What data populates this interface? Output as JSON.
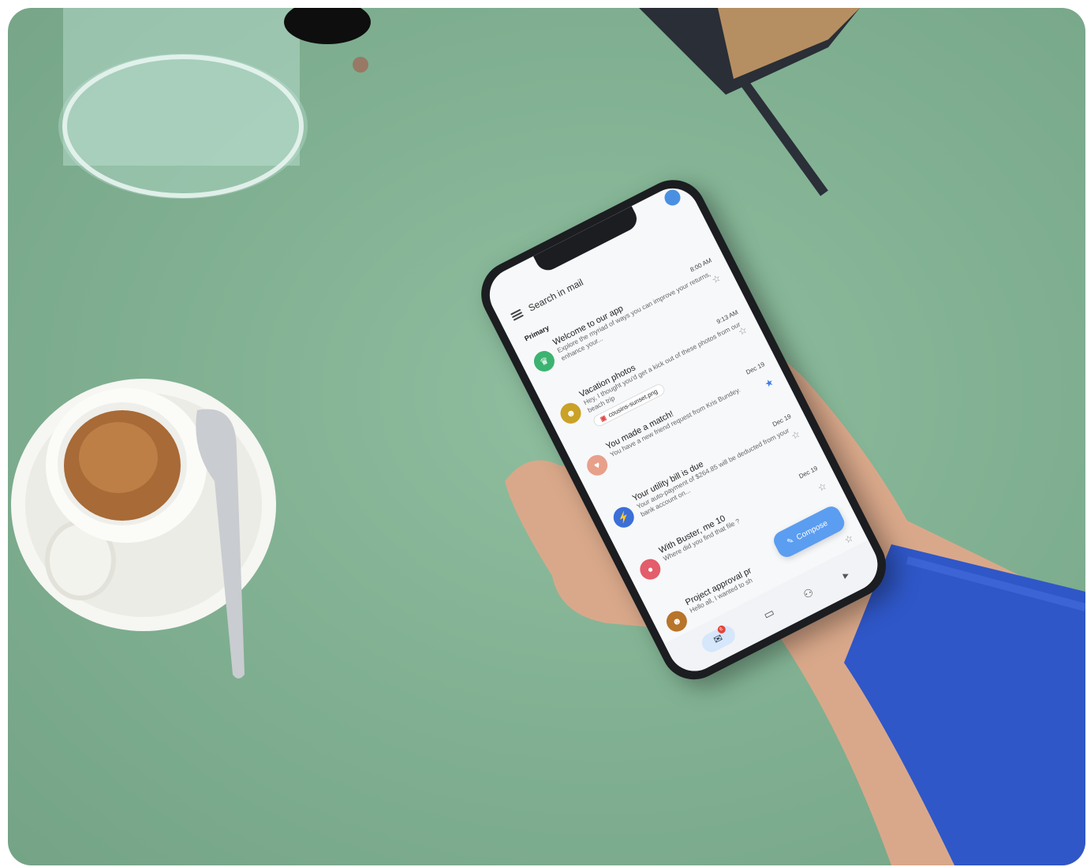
{
  "scene": {
    "background_color": "#82b293"
  },
  "app": {
    "search_placeholder": "Search in mail",
    "section_label": "Primary",
    "compose_label": "Compose",
    "mail_badge": "6",
    "emails": [
      {
        "sender": "Welcome to our app",
        "snippet": "Explore the myriad of ways you can improve your returns, enhance your...",
        "time": "8:00 AM",
        "starred": false,
        "avatar_color": "#3cb371",
        "avatar_glyph": "♛"
      },
      {
        "sender": "Vacation photos",
        "snippet": "Hey, I thought you'd get a kick out of these photos from our beach trip",
        "time": "9:13 AM",
        "starred": false,
        "avatar_color": "#c9a227",
        "avatar_glyph": "☻",
        "attachment": "cousins-sunset.png"
      },
      {
        "sender": "You made a match!",
        "snippet": "You have a new friend request from Kris Bundey.",
        "time": "Dec 19",
        "starred": true,
        "avatar_color": "#e8a08a",
        "avatar_glyph": "♥"
      },
      {
        "sender": "Your utility bill is due",
        "snippet": "Your auto-payment of $264.85 will be deducted from your bank account on...",
        "time": "Dec 19",
        "starred": false,
        "avatar_color": "#3b6fd8",
        "avatar_glyph": "⚡"
      },
      {
        "sender": "With Buster, me 10",
        "snippet": "Where did you find that file ?",
        "time": "Dec 19",
        "starred": false,
        "avatar_color": "#e35d6a",
        "avatar_glyph": "●"
      },
      {
        "sender": "Project approval pr",
        "snippet": "Hello all, I wanted to sh",
        "time": "",
        "starred": false,
        "avatar_color": "#b8742a",
        "avatar_glyph": "☻"
      }
    ]
  }
}
